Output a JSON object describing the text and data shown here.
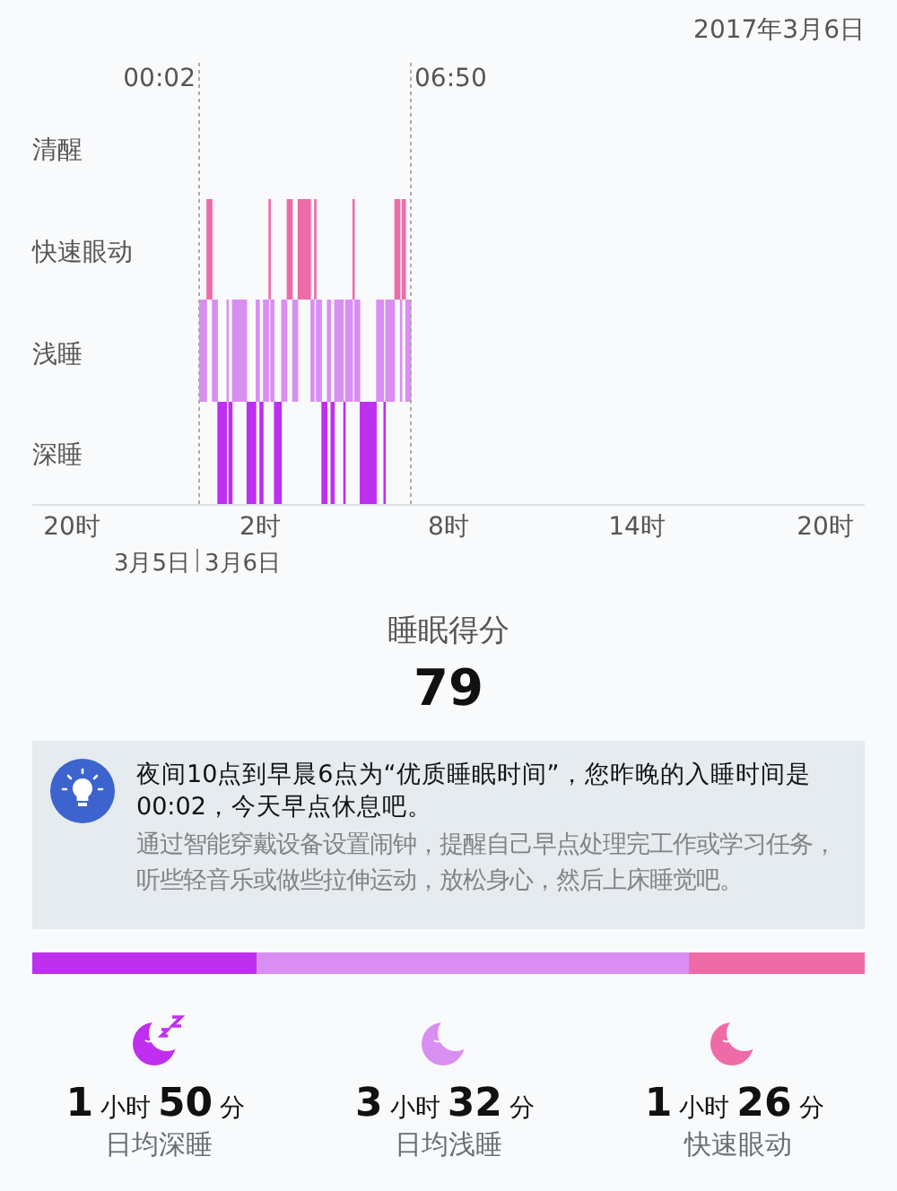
{
  "date": "2017年3月6日",
  "chart": {
    "bedtime": "00:02",
    "waketime": "06:50",
    "stages": [
      "清醒",
      "快速眼动",
      "浅睡",
      "深睡"
    ],
    "x_labels": [
      "20时",
      "2时",
      "8时",
      "14时",
      "20时"
    ],
    "day_labels": [
      "3月5日",
      "3月6日"
    ]
  },
  "score": {
    "label": "睡眠得分",
    "value": "79"
  },
  "tip": {
    "headline": "夜间10点到早晨6点为“优质睡眠时间”，您昨晚的入睡时间是00:02，今天早点休息吧。",
    "advice": "通过智能穿戴设备设置闹钟，提醒自己早点处理完工作或学习任务，听些轻音乐或做些拉伸运动，放松身心，然后上床睡觉吧。"
  },
  "stats": [
    {
      "kind": "deep",
      "color": "#bf2ff0",
      "hours": "1",
      "hour_unit": "小时",
      "minutes": "50",
      "minute_unit": "分",
      "label": "日均深睡"
    },
    {
      "kind": "light",
      "color": "#d98ef2",
      "hours": "3",
      "hour_unit": "小时",
      "minutes": "32",
      "minute_unit": "分",
      "label": "日均浅睡"
    },
    {
      "kind": "rem",
      "color": "#ee6ba8",
      "hours": "1",
      "hour_unit": "小时",
      "minutes": "26",
      "minute_unit": "分",
      "label": "快速眼动"
    }
  ]
}
